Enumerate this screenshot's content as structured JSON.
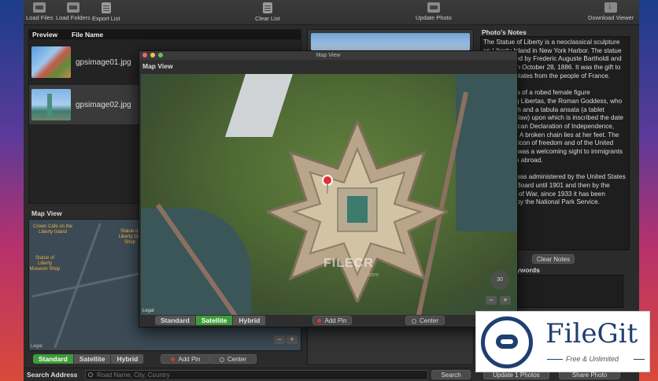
{
  "toolbar": {
    "load_files": "Load Files",
    "load_folders": "Load Folders",
    "export_list": "Export List",
    "clear_list": "Clear List",
    "update_photo": "Update Photo",
    "download_viewer": "Download Viewer"
  },
  "file_list": {
    "headers": {
      "preview": "Preview",
      "file_name": "File Name"
    },
    "rows": [
      {
        "name": "gpsimage01.jpg"
      },
      {
        "name": "gpsimage02.jpg"
      }
    ]
  },
  "bg_map": {
    "label": "Map View",
    "poi1": "Crown Cafe on the Liberty Island",
    "poi2": "Statue of Liberty Gift Shop",
    "poi3": "Statue of Liberty Museum Shop",
    "legal": "Legal",
    "zoom_out": "−",
    "zoom_in": "+"
  },
  "map_modes": {
    "standard": "Standard",
    "satellite": "Satellite",
    "hybrid": "Hybrid",
    "selected": "Satellite"
  },
  "actions": {
    "add_pin": "Add Pin",
    "center": "Center"
  },
  "map_window": {
    "window_title": "Map View",
    "heading": "Map View",
    "legal": "Legal",
    "compass": "30",
    "zoom_out": "−",
    "zoom_in": "+",
    "watermark": "FILECR",
    "watermark_sub": ".com"
  },
  "notes": {
    "title": "Photo's Notes",
    "text": "The Statue of Liberty is a neoclassical sculpture on Liberty Island in New York Harbor. The statue was designed by Frederic Auguste Bartholdi and dedicated on October 28, 1886. It was the gift to the United States from the people of France.\n\nThe statue is of a robed female figure representing Libertas, the Roman Goddess, who bears a torch and a tabula ansata (a tablet evoking the law) upon which is inscribed the date of the American Declaration of Independence, July 4 1776. A broken chain lies at her feet. The statue is an icon of freedom and of the United States, and was a welcoming sight to immigrants arriving from abroad.\n\nThe statue was administered by the United States Lighthouse Board until 1901 and then by the Department of War, since 1933 it has been maintained by the National Park Service.",
    "clear_button": "Clear Notes",
    "keywords_title": "Photo's Keywords"
  },
  "bottom": {
    "search_label": "Search Address",
    "search_placeholder": "Road Name, City, Country",
    "search_button": "Search",
    "update_button": "Update 1 Photos",
    "share_button": "Share Photo"
  },
  "badge": {
    "title": "FileGit",
    "subtitle": "Free & Unlimited"
  },
  "colors": {
    "accent_green": "#3e9b3a",
    "pin_red": "#d33333",
    "badge_blue": "#1f3f70"
  }
}
